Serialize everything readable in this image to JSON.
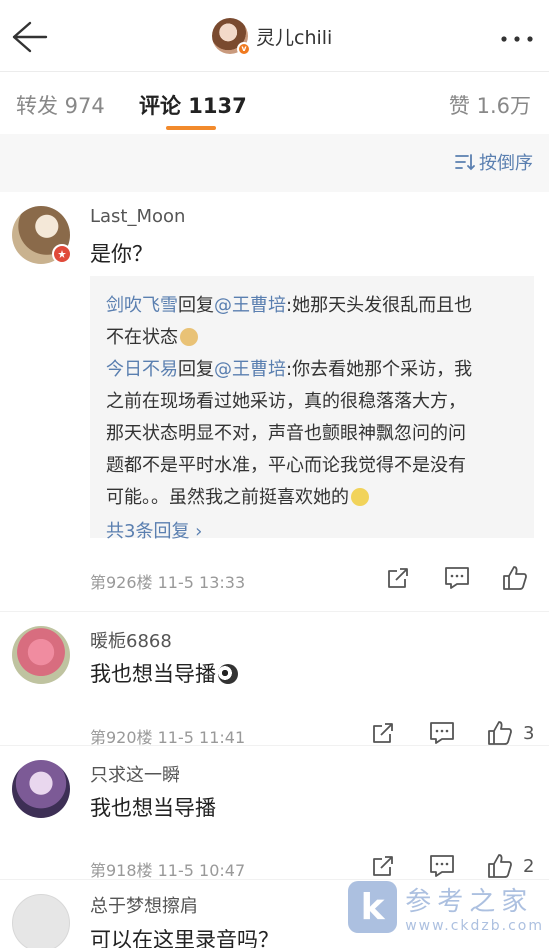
{
  "header": {
    "profile_name": "灵儿chili",
    "back_icon": "arrow-left-icon",
    "more_icon": "more-dots-icon"
  },
  "tabs": {
    "reposts": "转发 974",
    "comments": "评论 1137",
    "likes": "赞 1.6万",
    "accent": "#f28a2c"
  },
  "sort": {
    "label": "按倒序"
  },
  "comments": [
    {
      "user": "Last_Moon",
      "text": "是你？",
      "meta": "第926楼  11-5 13:33",
      "likes": "",
      "replies": [
        {
          "author": "剑吹飞雪",
          "verb": "回复",
          "mention": "@王曹培",
          "text": ":她那天头发很乱而且也",
          "text2": "不在状态"
        },
        {
          "author": "今日不易",
          "verb": "回复",
          "mention": "@王曹培",
          "text": ":你去看她那个采访，我",
          "text2": "之前在现场看过她采访，真的很稳落落大方，",
          "text3": "那天状态明显不对，声音也颤眼神飘忽问的问",
          "text4": "题都不是平时水准，平心而论我觉得不是没有",
          "text5": "可能。。虽然我之前挺喜欢她的"
        }
      ],
      "more_replies": "共3条回复 ›"
    },
    {
      "user": "暖栀6868",
      "text": "我也想当导播",
      "meta": "第920楼  11-5 11:41",
      "likes": "3"
    },
    {
      "user": "只求这一瞬",
      "text": "我也想当导播",
      "meta": "第918楼  11-5 10:47",
      "likes": "2"
    },
    {
      "user": "总于梦想擦肩",
      "text": "可以在这里录音吗？"
    }
  ],
  "watermark": {
    "logo": "k",
    "cn": "参考之家",
    "url": "www.ckdzb.com"
  },
  "colors": {
    "link": "#5a7fb0",
    "badge_orange": "#f07a20",
    "badge_red": "#e04a3a"
  }
}
